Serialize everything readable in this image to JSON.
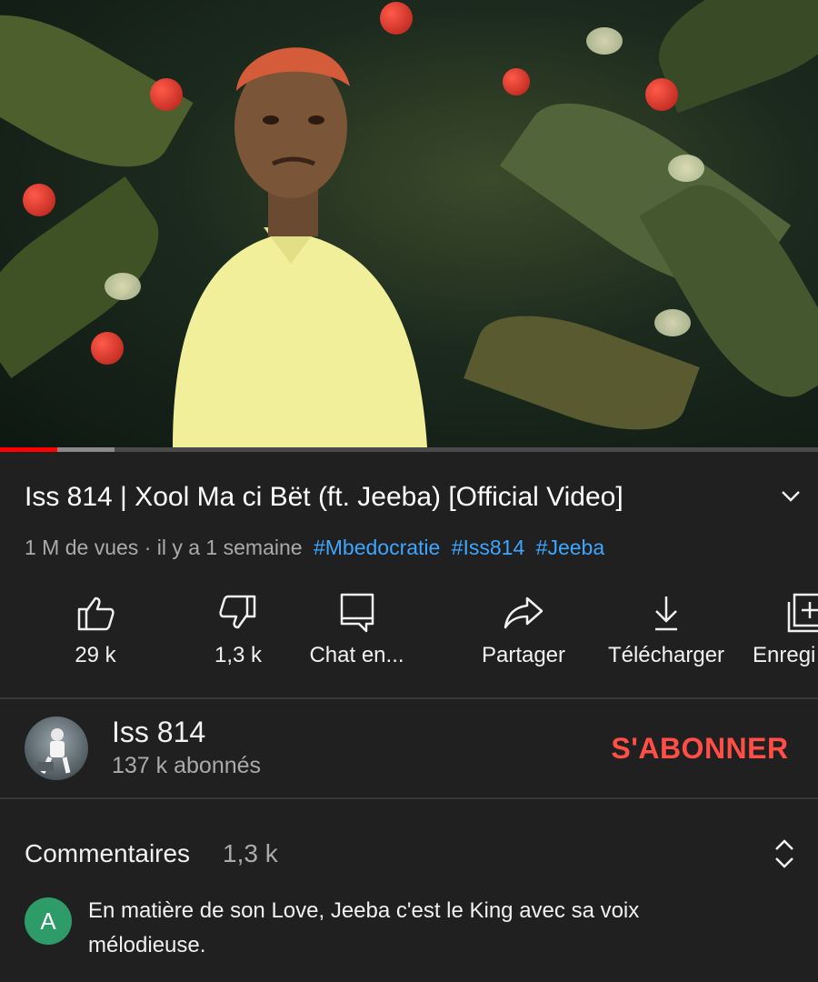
{
  "video": {
    "progress_played_fraction": 0.07,
    "progress_buffered_fraction": 0.14
  },
  "title": "Iss 814 | Xool Ma ci Bët (ft. Jeeba) [Official Video]",
  "meta": {
    "views": "1 M de vues",
    "separator": "·",
    "age": "il y a 1 semaine",
    "hashtags": [
      "#Mbedocratie",
      "#Iss814",
      "#Jeeba"
    ]
  },
  "actions": [
    {
      "icon": "thumbs-up-icon",
      "label": "29 k"
    },
    {
      "icon": "thumbs-down-icon",
      "label": "1,3 k"
    },
    {
      "icon": "chat-icon",
      "label": "Chat en..."
    },
    {
      "icon": "share-icon",
      "label": "Partager"
    },
    {
      "icon": "download-icon",
      "label": "Télécharger"
    },
    {
      "icon": "save-icon",
      "label": "Enregi"
    }
  ],
  "channel": {
    "name": "Iss 814",
    "subscribers": "137 k abonnés",
    "subscribe_label": "S'ABONNER"
  },
  "comments": {
    "header": "Commentaires",
    "count": "1,3 k",
    "first": {
      "avatar_letter": "A",
      "text": "En matière de son Love, Jeeba c'est le King avec sa voix mélodieuse."
    }
  },
  "colors": {
    "background": "#202020",
    "hashtag": "#3ea6ff",
    "subscribe": "#ff4e45",
    "progress_played": "#ff0000",
    "comment_avatar": "#2e9c69"
  }
}
